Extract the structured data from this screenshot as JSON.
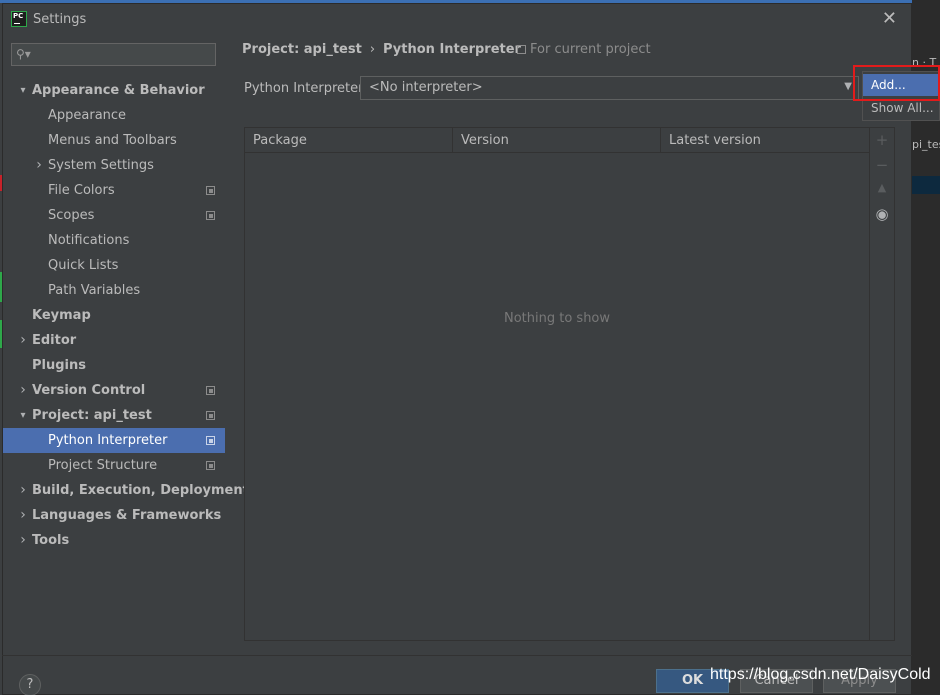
{
  "window": {
    "title": "Settings",
    "app_icon_text": "PC"
  },
  "search": {
    "placeholder": ""
  },
  "sidebar": {
    "items": [
      {
        "label": "Appearance & Behavior",
        "level": 0,
        "bold": true,
        "chevron": "down"
      },
      {
        "label": "Appearance",
        "level": 1
      },
      {
        "label": "Menus and Toolbars",
        "level": 1
      },
      {
        "label": "System Settings",
        "level": 1,
        "chevron": "right"
      },
      {
        "label": "File Colors",
        "level": 1,
        "copy_icon": true
      },
      {
        "label": "Scopes",
        "level": 1,
        "copy_icon": true
      },
      {
        "label": "Notifications",
        "level": 1
      },
      {
        "label": "Quick Lists",
        "level": 1
      },
      {
        "label": "Path Variables",
        "level": 1
      },
      {
        "label": "Keymap",
        "level": 0,
        "bold": true
      },
      {
        "label": "Editor",
        "level": 0,
        "bold": true,
        "chevron": "right"
      },
      {
        "label": "Plugins",
        "level": 0,
        "bold": true
      },
      {
        "label": "Version Control",
        "level": 0,
        "bold": true,
        "chevron": "right",
        "copy_icon": true
      },
      {
        "label": "Project: api_test",
        "level": 0,
        "bold": true,
        "chevron": "down",
        "copy_icon": true
      },
      {
        "label": "Python Interpreter",
        "level": 1,
        "selected": true,
        "copy_icon": true
      },
      {
        "label": "Project Structure",
        "level": 1,
        "copy_icon": true
      },
      {
        "label": "Build, Execution, Deployment",
        "level": 0,
        "bold": true,
        "chevron": "right"
      },
      {
        "label": "Languages & Frameworks",
        "level": 0,
        "bold": true,
        "chevron": "right"
      },
      {
        "label": "Tools",
        "level": 0,
        "bold": true,
        "chevron": "right"
      }
    ]
  },
  "breadcrumb": {
    "project": "Project: api_test",
    "separator": "›",
    "page": "Python Interpreter"
  },
  "scope_note": "For current project",
  "interpreter": {
    "label": "Python Interpreter:",
    "value": "<No interpreter>"
  },
  "packages": {
    "columns": [
      "Package",
      "Version",
      "Latest version"
    ],
    "empty_text": "Nothing to show"
  },
  "popup": {
    "items": [
      "Add...",
      "Show All..."
    ],
    "highlighted_index": 0
  },
  "buttons": {
    "ok": "OK",
    "cancel": "Cancel",
    "apply": "Apply",
    "help": "?"
  },
  "background": {
    "fragment_top": "n · T",
    "fragment_mid": "pi_tes"
  },
  "watermark": "https://blog.csdn.net/DaisyCold",
  "colors": {
    "selection": "#4b6eaf",
    "dialog_bg": "#3c3f41",
    "highlight_box": "#e21b1b",
    "ok_button": "#365880"
  }
}
